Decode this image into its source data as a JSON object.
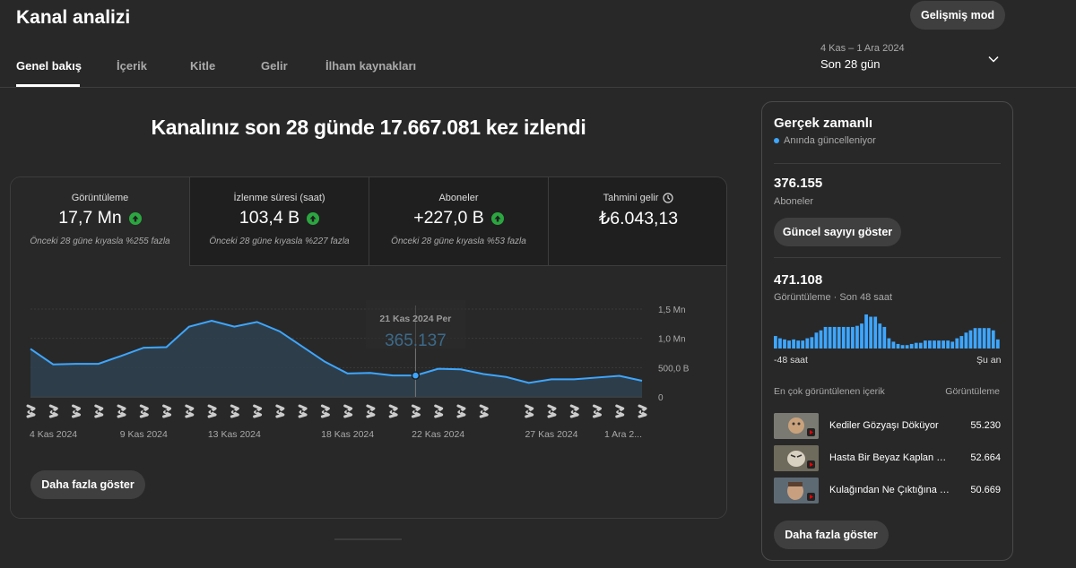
{
  "header": {
    "title": "Kanal analizi",
    "advanced_mode": "Gelişmiş mod",
    "tabs": [
      {
        "label": "Genel bakış",
        "active": true
      },
      {
        "label": "İçerik"
      },
      {
        "label": "Kitle"
      },
      {
        "label": "Gelir"
      },
      {
        "label": "İlham kaynakları"
      }
    ],
    "date_range": {
      "dates": "4 Kas – 1 Ara 2024",
      "label": "Son 28 gün",
      "icon": "chevron-down-icon"
    }
  },
  "overview": {
    "headline": "Kanalınız son 28 günde 17.667.081 kez izlendi",
    "metrics": [
      {
        "label": "Görüntüleme",
        "value": "17,7 Mn",
        "trend": "up",
        "compare": "Önceki 28 güne kıyasla %255 fazla",
        "active": true
      },
      {
        "label": "İzlenme süresi (saat)",
        "value": "103,4 B",
        "trend": "up",
        "compare": "Önceki 28 güne kıyasla %227 fazla"
      },
      {
        "label": "Aboneler",
        "value": "+227,0 B",
        "trend": "up",
        "compare": "Önceki 28 güne kıyasla %53 fazla"
      },
      {
        "label": "Tahmini gelir",
        "value": "₺6.043,13",
        "icon": "clock-icon"
      }
    ],
    "more_button": "Daha fazla göster",
    "colors": {
      "line": "#3ea6ff",
      "area": "#2e4250",
      "up": "#2ba640"
    }
  },
  "chart_data": {
    "type": "area",
    "x": [
      "4 Kas 2024",
      "5 Kas 2024",
      "6 Kas 2024",
      "7 Kas 2024",
      "8 Kas 2024",
      "9 Kas 2024",
      "10 Kas 2024",
      "11 Kas 2024",
      "12 Kas 2024",
      "13 Kas 2024",
      "14 Kas 2024",
      "15 Kas 2024",
      "16 Kas 2024",
      "17 Kas 2024",
      "18 Kas 2024",
      "19 Kas 2024",
      "20 Kas 2024",
      "21 Kas 2024",
      "22 Kas 2024",
      "23 Kas 2024",
      "24 Kas 2024",
      "25 Kas 2024",
      "26 Kas 2024",
      "27 Kas 2024",
      "28 Kas 2024",
      "29 Kas 2024",
      "30 Kas 2024",
      "1 Ara 2024"
    ],
    "values": [
      820000,
      555000,
      565000,
      565000,
      700000,
      840000,
      850000,
      1200000,
      1300000,
      1200000,
      1280000,
      1120000,
      860000,
      600000,
      400000,
      410000,
      365000,
      365137,
      480000,
      470000,
      390000,
      340000,
      240000,
      300000,
      300000,
      330000,
      360000,
      275000
    ],
    "x_tick_labels": [
      {
        "index": 0,
        "label": "4 Kas 2024"
      },
      {
        "index": 5,
        "label": "9 Kas 2024"
      },
      {
        "index": 9,
        "label": "13 Kas 2024"
      },
      {
        "index": 14,
        "label": "18 Kas 2024"
      },
      {
        "index": 18,
        "label": "22 Kas 2024"
      },
      {
        "index": 23,
        "label": "27 Kas 2024"
      },
      {
        "index": 27,
        "label": "1 Ara 2..."
      }
    ],
    "y_ticks": [
      {
        "value": 0,
        "label": "0"
      },
      {
        "value": 500000,
        "label": "500,0 B"
      },
      {
        "value": 1000000,
        "label": "1,0 Mn"
      },
      {
        "value": 1500000,
        "label": "1,5 Mn"
      }
    ],
    "ylim": [
      0,
      1500000
    ],
    "tooltip": {
      "index": 17,
      "date": "21 Kas 2024 Per",
      "value": "365.137"
    },
    "shorts_markers": [
      0,
      1,
      2,
      3,
      4,
      5,
      6,
      7,
      8,
      9,
      10,
      11,
      12,
      13,
      14,
      15,
      16,
      17,
      18,
      19,
      20,
      22,
      23,
      24,
      25,
      26,
      27
    ],
    "grid": true
  },
  "realtime": {
    "title": "Gerçek zamanlı",
    "live_label": "Anında güncelleniyor",
    "subscribers": "376.155",
    "subscribers_label": "Aboneler",
    "show_count_button": "Güncel sayıyı göster",
    "views": "471.108",
    "views_label": "Görüntüleme · Son 48 saat",
    "axis_left": "-48 saat",
    "axis_right": "Şu an",
    "bars": [
      11,
      9,
      8,
      7,
      8,
      7,
      7,
      9,
      10,
      14,
      16,
      19,
      19,
      19,
      19,
      19,
      19,
      19,
      20,
      22,
      30,
      28,
      28,
      22,
      19,
      9,
      6,
      4,
      3,
      3,
      4,
      5,
      5,
      7,
      7,
      7,
      7,
      7,
      7,
      6,
      9,
      11,
      14,
      16,
      18,
      18,
      18,
      18,
      16,
      8
    ],
    "top_content_title": "En çok görüntülenen içerik",
    "top_content_col": "Görüntüleme",
    "top_content": [
      {
        "title": "Kediler Gözyaşı Döküyor",
        "views": "55.230"
      },
      {
        "title": "Hasta Bir Beyaz Kaplan Kurtarıldı",
        "views": "52.664"
      },
      {
        "title": "Kulağından Ne Çıktığına İnanamayacaksınız",
        "views": "50.669"
      }
    ],
    "more_button": "Daha fazla göster"
  }
}
